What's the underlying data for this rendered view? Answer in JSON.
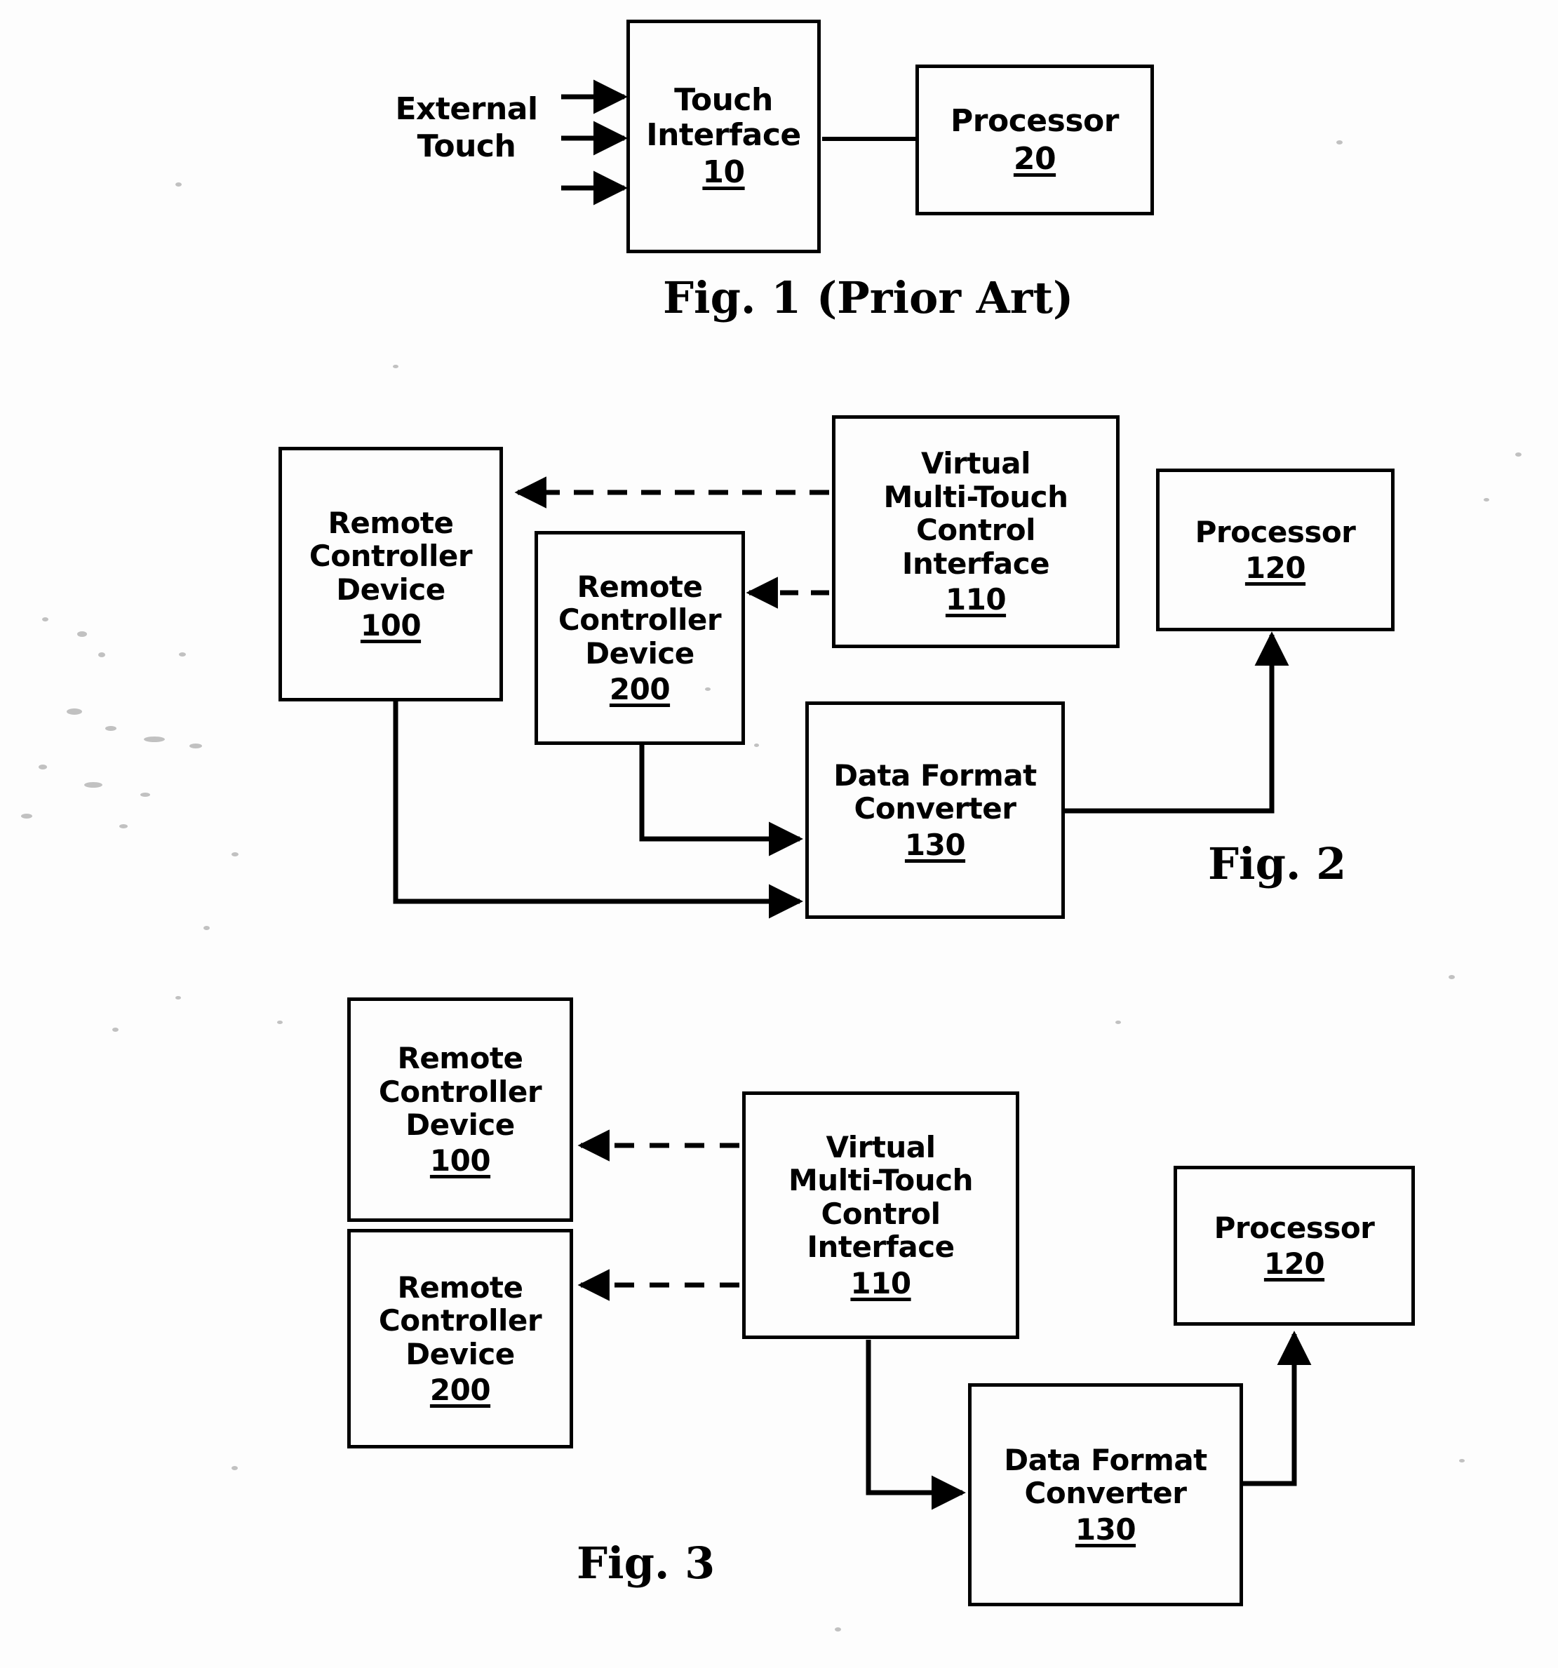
{
  "document": {
    "type": "patent-drawing-sheet",
    "figures": [
      {
        "id": "fig1",
        "caption": "Fig. 1 (Prior Art)",
        "input_label": "External\nTouch",
        "input_label_lines": [
          "External",
          "Touch"
        ],
        "arrow_count_into_touch_interface": 3,
        "blocks": [
          {
            "id": "touch-interface",
            "lines": [
              "Touch",
              "Interface"
            ],
            "ref": "10"
          },
          {
            "id": "processor-20",
            "lines": [
              "Processor"
            ],
            "ref": "20"
          }
        ],
        "connections": [
          {
            "from": "external-touch",
            "to": "touch-interface",
            "style": "solid-arrow",
            "count": 3
          },
          {
            "from": "touch-interface",
            "to": "processor-20",
            "style": "solid-line"
          }
        ]
      },
      {
        "id": "fig2",
        "caption": "Fig. 2",
        "blocks": [
          {
            "id": "remote-controller-100",
            "lines": [
              "Remote",
              "Controller",
              "Device"
            ],
            "ref": "100"
          },
          {
            "id": "remote-controller-200",
            "lines": [
              "Remote",
              "Controller",
              "Device"
            ],
            "ref": "200"
          },
          {
            "id": "virtual-multi-touch-110",
            "lines": [
              "Virtual",
              "Multi-Touch",
              "Control",
              "Interface"
            ],
            "ref": "110"
          },
          {
            "id": "processor-120",
            "lines": [
              "Processor"
            ],
            "ref": "120"
          },
          {
            "id": "data-format-converter-130",
            "lines": [
              "Data Format",
              "Converter"
            ],
            "ref": "130"
          }
        ],
        "connections": [
          {
            "from": "virtual-multi-touch-110",
            "to": "remote-controller-100",
            "style": "dashed-arrow"
          },
          {
            "from": "virtual-multi-touch-110",
            "to": "remote-controller-200",
            "style": "dashed-arrow"
          },
          {
            "from": "remote-controller-100",
            "to": "data-format-converter-130",
            "style": "solid-arrow"
          },
          {
            "from": "remote-controller-200",
            "to": "data-format-converter-130",
            "style": "solid-arrow"
          },
          {
            "from": "data-format-converter-130",
            "to": "processor-120",
            "style": "solid-arrow"
          }
        ]
      },
      {
        "id": "fig3",
        "caption": "Fig. 3",
        "blocks": [
          {
            "id": "remote-controller-100",
            "lines": [
              "Remote",
              "Controller",
              "Device"
            ],
            "ref": "100"
          },
          {
            "id": "remote-controller-200",
            "lines": [
              "Remote",
              "Controller",
              "Device"
            ],
            "ref": "200"
          },
          {
            "id": "virtual-multi-touch-110",
            "lines": [
              "Virtual",
              "Multi-Touch",
              "Control",
              "Interface"
            ],
            "ref": "110"
          },
          {
            "id": "processor-120",
            "lines": [
              "Processor"
            ],
            "ref": "120"
          },
          {
            "id": "data-format-converter-130",
            "lines": [
              "Data Format",
              "Converter"
            ],
            "ref": "130"
          }
        ],
        "connections": [
          {
            "from": "virtual-multi-touch-110",
            "to": "remote-controller-100",
            "style": "dashed-arrow"
          },
          {
            "from": "virtual-multi-touch-110",
            "to": "remote-controller-200",
            "style": "dashed-arrow"
          },
          {
            "from": "virtual-multi-touch-110",
            "to": "data-format-converter-130",
            "style": "solid-arrow"
          },
          {
            "from": "data-format-converter-130",
            "to": "processor-120",
            "style": "solid-arrow"
          }
        ]
      }
    ]
  },
  "fig1": {
    "caption": "Fig. 1 (Prior Art)",
    "external_touch_l1": "External",
    "external_touch_l2": "Touch",
    "touch_interface_l1": "Touch",
    "touch_interface_l2": "Interface",
    "touch_interface_ref": "10",
    "processor_l1": "Processor",
    "processor_ref": "20"
  },
  "fig2": {
    "caption": "Fig. 2",
    "rcd100_l1": "Remote",
    "rcd100_l2": "Controller",
    "rcd100_l3": "Device",
    "rcd100_ref": "100",
    "rcd200_l1": "Remote",
    "rcd200_l2": "Controller",
    "rcd200_l3": "Device",
    "rcd200_ref": "200",
    "vmtci_l1": "Virtual",
    "vmtci_l2": "Multi-Touch",
    "vmtci_l3": "Control",
    "vmtci_l4": "Interface",
    "vmtci_ref": "110",
    "processor_l1": "Processor",
    "processor_ref": "120",
    "dfc_l1": "Data Format",
    "dfc_l2": "Converter",
    "dfc_ref": "130"
  },
  "fig3": {
    "caption": "Fig. 3",
    "rcd100_l1": "Remote",
    "rcd100_l2": "Controller",
    "rcd100_l3": "Device",
    "rcd100_ref": "100",
    "rcd200_l1": "Remote",
    "rcd200_l2": "Controller",
    "rcd200_l3": "Device",
    "rcd200_ref": "200",
    "vmtci_l1": "Virtual",
    "vmtci_l2": "Multi-Touch",
    "vmtci_l3": "Control",
    "vmtci_l4": "Interface",
    "vmtci_ref": "110",
    "processor_l1": "Processor",
    "processor_ref": "120",
    "dfc_l1": "Data Format",
    "dfc_l2": "Converter",
    "dfc_ref": "130"
  },
  "colors": {
    "ink": "#000000",
    "paper": "#fdfdfd",
    "speck": "#8f8f8f"
  }
}
